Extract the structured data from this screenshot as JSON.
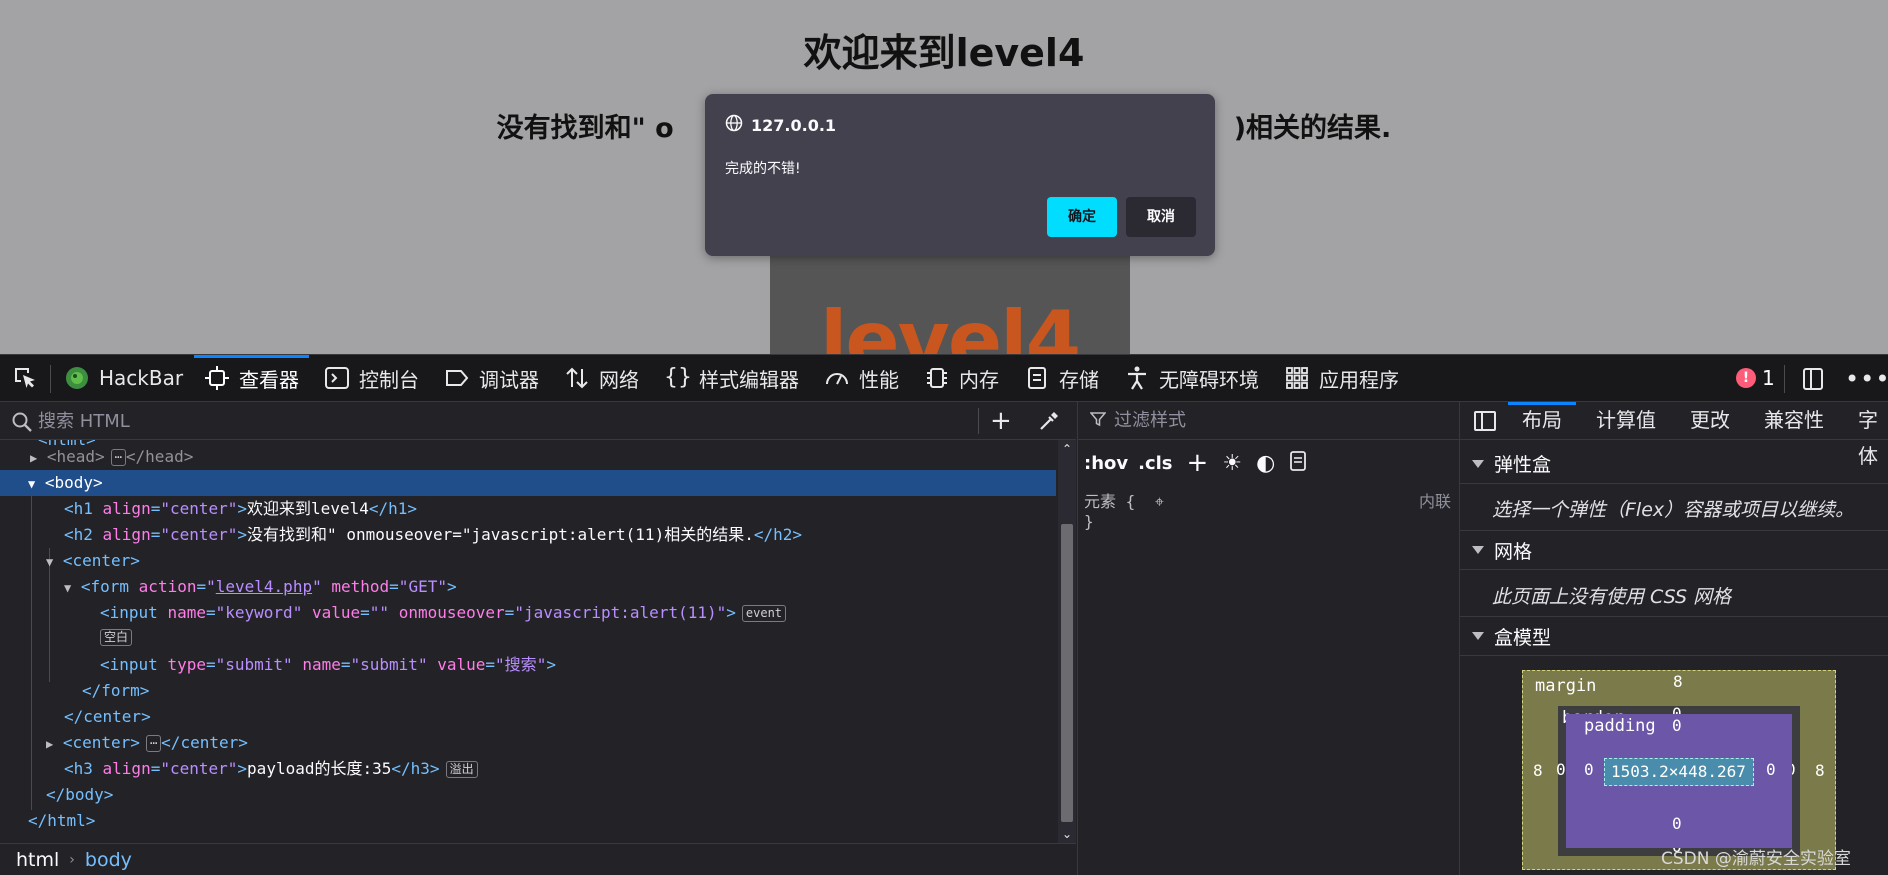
{
  "page": {
    "h1": "欢迎来到level4",
    "h2": "没有找到和\" o",
    "h2_tail": ")相关的结果.",
    "image_text": "level4"
  },
  "dialog": {
    "origin": "127.0.0.1",
    "message": "完成的不错!",
    "ok_label": "确定",
    "cancel_label": "取消"
  },
  "toolbar": {
    "tabs": [
      {
        "label": "HackBar",
        "icon": "hackbar-icon"
      },
      {
        "label": "查看器",
        "icon": "inspector-icon"
      },
      {
        "label": "控制台",
        "icon": "console-icon"
      },
      {
        "label": "调试器",
        "icon": "debugger-icon"
      },
      {
        "label": "网络",
        "icon": "network-icon"
      },
      {
        "label": "样式编辑器",
        "icon": "style-editor-icon"
      },
      {
        "label": "性能",
        "icon": "performance-icon"
      },
      {
        "label": "内存",
        "icon": "memory-icon"
      },
      {
        "label": "存储",
        "icon": "storage-icon"
      },
      {
        "label": "无障碍环境",
        "icon": "accessibility-icon"
      },
      {
        "label": "应用程序",
        "icon": "application-icon"
      }
    ],
    "active_tab": "查看器",
    "error_count": "1"
  },
  "markup": {
    "search_placeholder": "搜索 HTML",
    "lines": {
      "head_open": "<head>",
      "head_close": "</head>",
      "body_open": "<body>",
      "h1_text": "欢迎来到level4",
      "h2_text": "没有找到和\" onmouseover=\"javascript:alert(11)相关的结果.",
      "form_action": "level4.php",
      "form_method": "GET",
      "input1_name": "keyword",
      "input1_value": "",
      "input1_onmouseover": "javascript:alert(11)",
      "badge_event": "event",
      "badge_whitespace": "空白",
      "input2_type": "submit",
      "input2_name": "submit",
      "input2_value": "搜索",
      "h3_text": "payload的长度:35",
      "badge_overflow": "溢出",
      "ellipsis": "⋯"
    }
  },
  "breadcrumb": [
    "html",
    "body"
  ],
  "rules": {
    "filter_placeholder": "过滤样式",
    "hov": ":hov",
    "cls": ".cls",
    "element_label": "元素 {",
    "inline_label": "内联",
    "close_brace": "}"
  },
  "layout": {
    "tabs": [
      "布局",
      "计算值",
      "更改",
      "兼容性",
      "字体"
    ],
    "active_tab": "布局",
    "flexbox_title": "弹性盒",
    "flexbox_note": "选择一个弹性（Flex）容器或项目以继续。",
    "grid_title": "网格",
    "grid_note": "此页面上没有使用 CSS 网格",
    "boxmodel_title": "盒模型",
    "box": {
      "margin_label": "margin",
      "border_label": "border",
      "padding_label": "padding",
      "content_size": "1503.2×448.267",
      "margin_top": "8",
      "margin_left": "8",
      "margin_right": "8",
      "border_top": "0",
      "border_left": "0",
      "border_right": "0",
      "padding_top": "0",
      "padding_left": "0",
      "padding_right": "0",
      "padding_bottom": "0",
      "border_bottom": "0"
    }
  },
  "watermark": "CSDN @渝蔚安全实验室",
  "colors": {
    "accent": "#0a84ff",
    "selection": "#204e8a",
    "dialog_ok": "#00ddff"
  }
}
